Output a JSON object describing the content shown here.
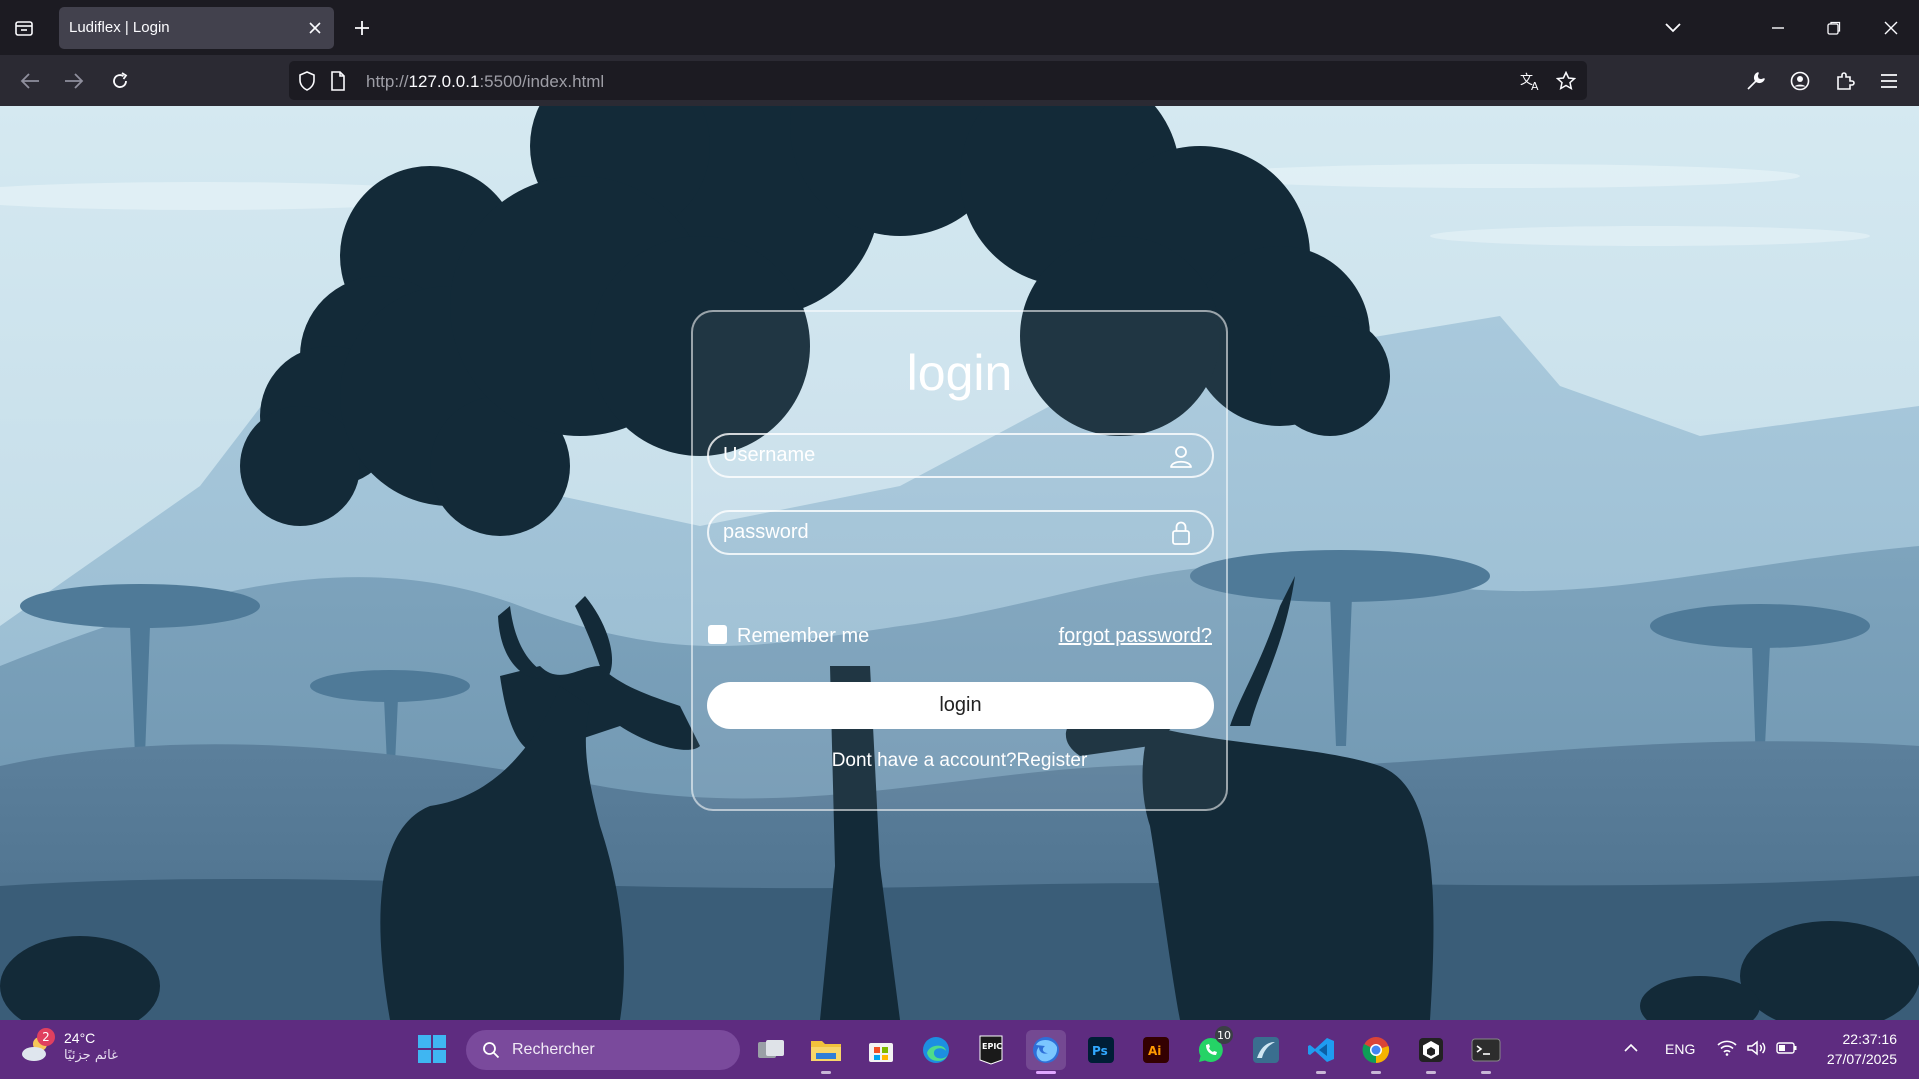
{
  "browser": {
    "tab_title": "Ludiflex | Login",
    "url_prefix": "http://",
    "url_host": "127.0.0.1",
    "url_suffix": ":5500/index.html",
    "icons": [
      "tab-list-icon",
      "close-icon",
      "plus-icon",
      "chevron-down-icon",
      "minimize-icon",
      "restore-icon",
      "window-close-icon",
      "back-arrow-icon",
      "forward-arrow-icon",
      "reload-icon",
      "shield-icon",
      "page-icon",
      "translate-icon",
      "bookmark-star-icon",
      "wrench-icon",
      "account-icon",
      "extensions-icon",
      "menu-icon"
    ]
  },
  "login_form": {
    "title": "login",
    "username_placeholder": "Username",
    "password_placeholder": "password",
    "remember_label": "Remember me",
    "forgot_label": "forgot password?",
    "submit_label": "login",
    "register_text": "Dont have a account?Register"
  },
  "taskbar": {
    "weather_temp": "24°C",
    "weather_desc": "غائم جزئيًا",
    "weather_badge": "2",
    "search_placeholder": "Rechercher",
    "apps": [
      {
        "name": "task-view",
        "badge": ""
      },
      {
        "name": "file-explorer",
        "badge": ""
      },
      {
        "name": "microsoft-store",
        "badge": ""
      },
      {
        "name": "edge",
        "badge": ""
      },
      {
        "name": "epic-games",
        "badge": ""
      },
      {
        "name": "firefox",
        "badge": ""
      },
      {
        "name": "photoshop",
        "badge": ""
      },
      {
        "name": "illustrator",
        "badge": ""
      },
      {
        "name": "whatsapp",
        "badge": "10"
      },
      {
        "name": "mysql-workbench",
        "badge": ""
      },
      {
        "name": "vscode",
        "badge": ""
      },
      {
        "name": "chrome",
        "badge": ""
      },
      {
        "name": "unity",
        "badge": ""
      },
      {
        "name": "terminal",
        "badge": ""
      }
    ],
    "language": "ENG",
    "time": "22:37:16",
    "date": "27/07/2025"
  },
  "colors": {
    "browser_dark": "#1c1b22",
    "browser_toolbar": "#2b2a33",
    "tab_active": "#42414d",
    "taskbar": "#5e2c80",
    "sky": "#cfe4ee",
    "silhouette": "#132a38"
  }
}
